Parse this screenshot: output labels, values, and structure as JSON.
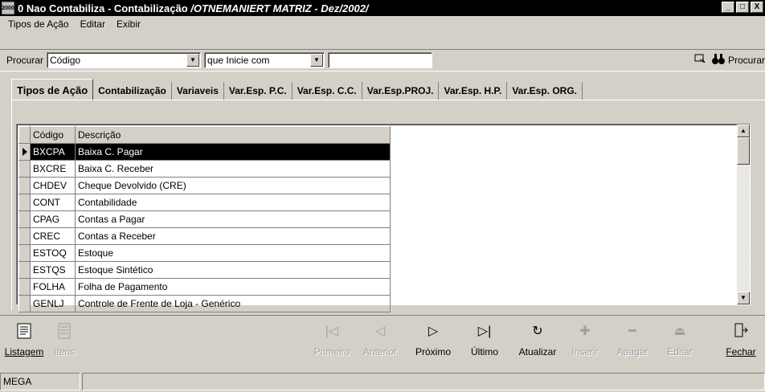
{
  "window": {
    "app_icon": "2000",
    "title_plain": "0 Nao Contabiliza - Contabilização",
    "title_italic": "/OTNEMANIERT MATRIZ - Dez/2002/",
    "min_label": "_",
    "max_label": "□",
    "close_label": "X"
  },
  "menu": {
    "items": [
      "Tipos de Ação",
      "Editar",
      "Exibir"
    ]
  },
  "search": {
    "label": "Procurar",
    "field_value": "Código",
    "mode_value": "que Inicie com",
    "text_value": "",
    "button_label": "Procurar",
    "icons": [
      "binoculars-icon",
      "filter-icon"
    ]
  },
  "tabs": [
    "Tipos de Ação",
    "Contabilização",
    "Variaveis",
    "Var.Esp. P.C.",
    "Var.Esp. C.C.",
    "Var.Esp.PROJ.",
    "Var.Esp. H.P.",
    "Var.Esp. ORG."
  ],
  "grid": {
    "columns": [
      "Código",
      "Descrição"
    ],
    "rows": [
      [
        "BXCPA",
        "Baixa C. Pagar"
      ],
      [
        "BXCRE",
        "Baixa C. Receber"
      ],
      [
        "CHDEV",
        "Cheque Devolvido (CRE)"
      ],
      [
        "CONT",
        "Contabilidade"
      ],
      [
        "CPAG",
        "Contas a Pagar"
      ],
      [
        "CREC",
        "Contas a Receber"
      ],
      [
        "ESTOQ",
        "Estoque"
      ],
      [
        "ESTQS",
        "Estoque Sintético"
      ],
      [
        "FOLHA",
        "Folha de Pagamento"
      ],
      [
        "GENLJ",
        "Controle de Frente de Loja - Genérico"
      ]
    ],
    "selected_index": 0
  },
  "toolbar": {
    "listagem": "Listagem",
    "itens": "Itens",
    "primeiro": "Primeiro",
    "anterior": "Anterior",
    "proximo": "Próximo",
    "ultimo": "Último",
    "atualizar": "Atualizar",
    "inserir": "Inserir",
    "apagar": "Apagar",
    "editar": "Editar",
    "fechar": "Fechar"
  },
  "status": {
    "cell1": "MEGA",
    "cell2": ""
  }
}
